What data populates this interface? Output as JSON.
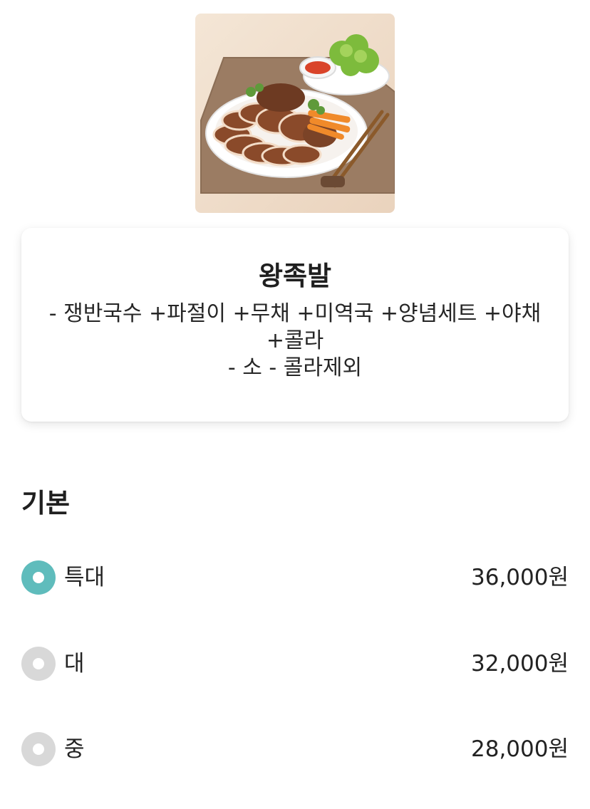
{
  "menu": {
    "name": "왕족발",
    "description_lines": [
      "- 쟁반국수 +파절이 +무채 +미역국 +양념세트 +야채",
      "+콜라",
      "- 소 - 콜라제외"
    ]
  },
  "options_section": {
    "title": "기본",
    "options": [
      {
        "label": "특대",
        "price": "36,000원",
        "selected": true
      },
      {
        "label": "대",
        "price": "32,000원",
        "selected": false
      },
      {
        "label": "중",
        "price": "28,000원",
        "selected": false
      }
    ]
  },
  "colors": {
    "accent": "#5fbcbc",
    "radio_unselected": "#d8d8d8"
  }
}
